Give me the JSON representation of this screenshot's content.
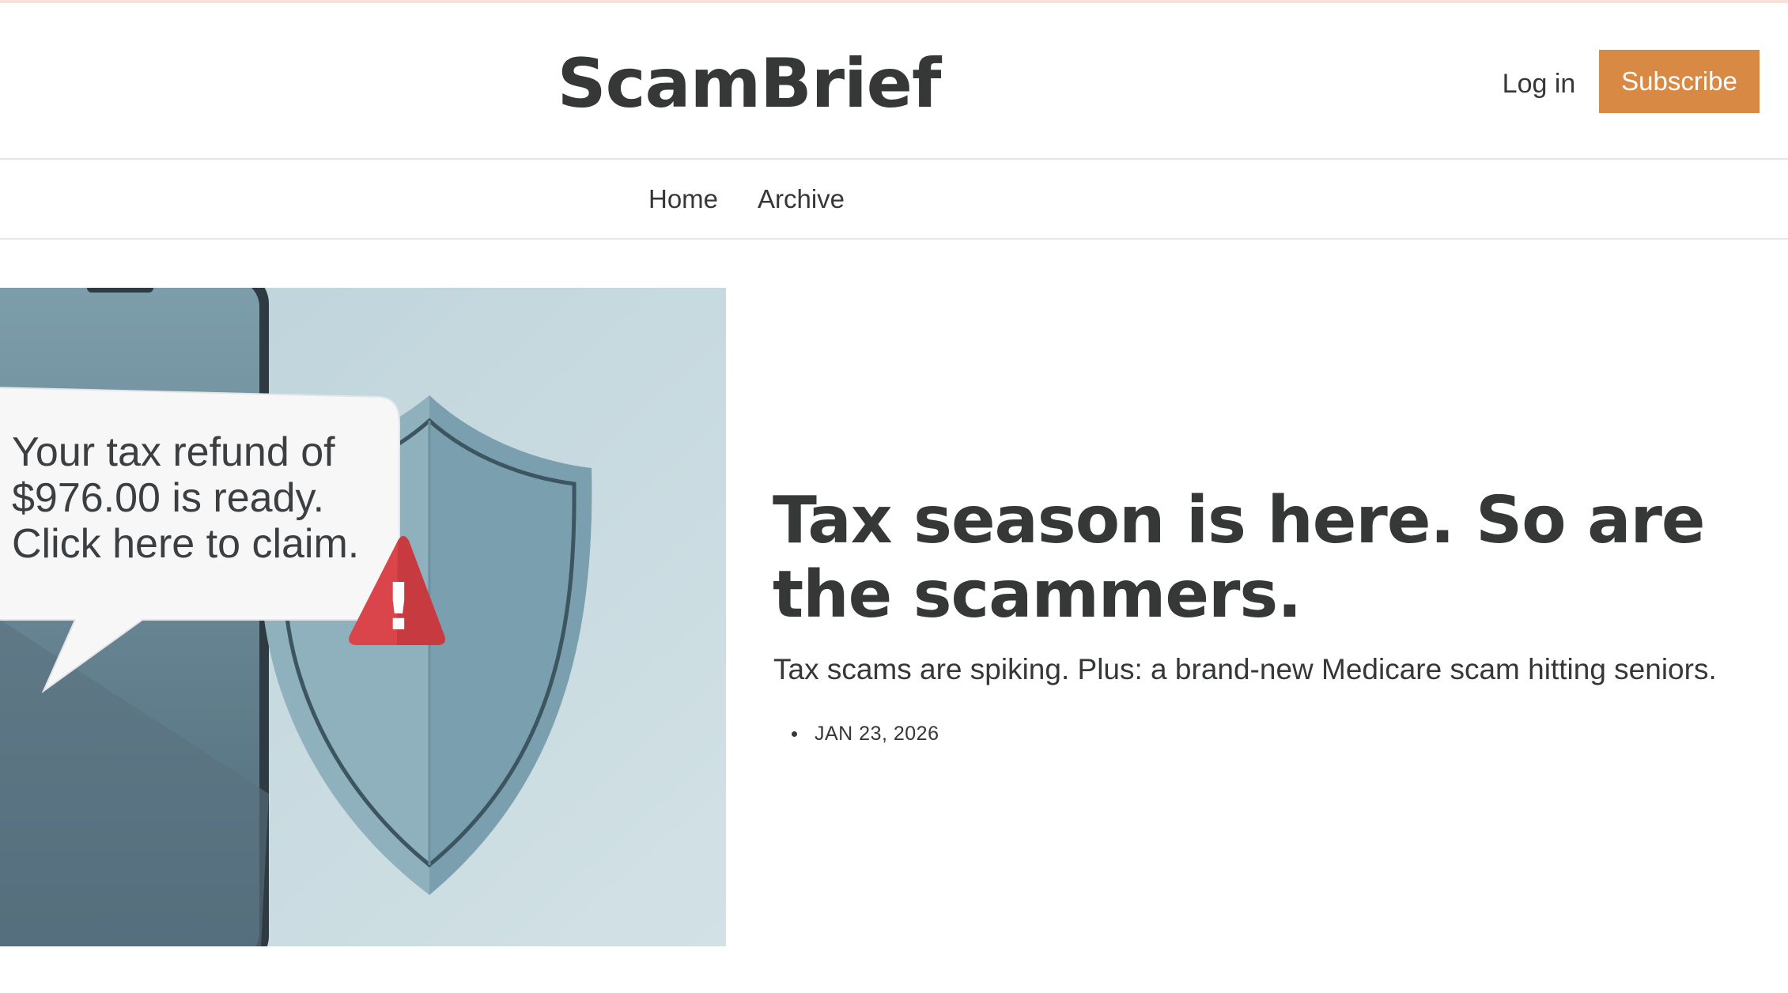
{
  "site": {
    "title": "ScamBrief",
    "accent_color": "#d88a44"
  },
  "header": {
    "login_label": "Log in",
    "subscribe_label": "Subscribe"
  },
  "nav": {
    "items": [
      {
        "label": "Home"
      },
      {
        "label": "Archive"
      }
    ]
  },
  "featured": {
    "image": {
      "message_lines": [
        "Your tax refund of",
        "$976.00 is ready.",
        "Click here to claim."
      ],
      "warning_symbol": "!",
      "icons": [
        "phone-icon",
        "shield-icon",
        "warning-icon"
      ]
    },
    "headline": "Tax season is here. So are the scammers.",
    "subtitle": "Tax scams are spiking. Plus: a brand-new Medicare scam hitting seniors.",
    "date": "JAN 23, 2026"
  }
}
